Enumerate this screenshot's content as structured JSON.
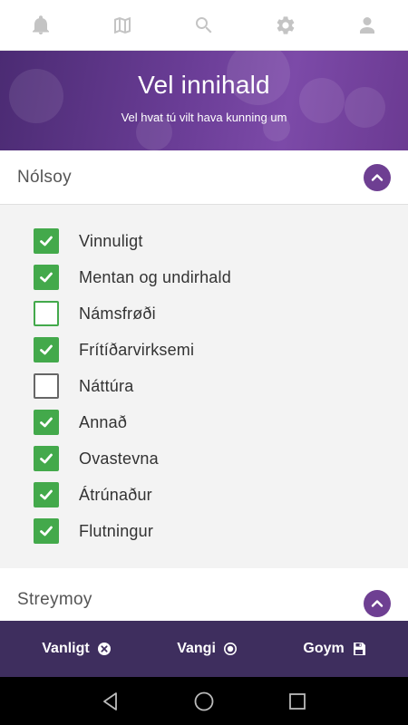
{
  "hero": {
    "title": "Vel innihald",
    "subtitle": "Vel hvat tú vilt hava kunning um"
  },
  "sections": [
    {
      "title": "Nólsoy",
      "expanded": true
    },
    {
      "title": "Streymoy",
      "expanded": false
    }
  ],
  "items": [
    {
      "label": "Vinnuligt",
      "checked": true
    },
    {
      "label": "Mentan og undirhald",
      "checked": true
    },
    {
      "label": "Námsfrøði",
      "checked": false
    },
    {
      "label": "Frítíðarvirksemi",
      "checked": true
    },
    {
      "label": "Náttúra",
      "checked": false
    },
    {
      "label": "Annað",
      "checked": true
    },
    {
      "label": "Ovastevna",
      "checked": true
    },
    {
      "label": "Átrúnaður",
      "checked": true
    },
    {
      "label": "Flutningur",
      "checked": true
    }
  ],
  "actions": {
    "cancel_label": "Vanligt",
    "default_label": "Vangi",
    "save_label": "Goym"
  },
  "colors": {
    "accent": "#6e3f92",
    "checkbox": "#43a94b",
    "actionbar": "#3e2e5e"
  }
}
